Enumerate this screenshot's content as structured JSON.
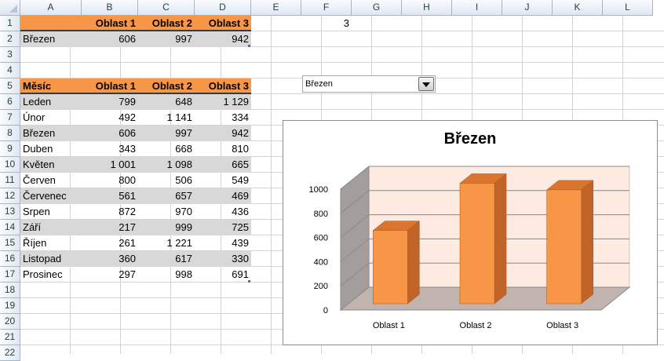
{
  "columns": [
    "A",
    "B",
    "C",
    "D",
    "E",
    "F",
    "G",
    "H",
    "I",
    "J",
    "K",
    "L"
  ],
  "rows": [
    "1",
    "2",
    "3",
    "4",
    "5",
    "6",
    "7",
    "8",
    "9",
    "10",
    "11",
    "12",
    "13",
    "14",
    "15",
    "16",
    "17",
    "18",
    "19",
    "20",
    "21",
    "22"
  ],
  "top_table": {
    "headers": [
      "Oblast 1",
      "Oblast 2",
      "Oblast 3"
    ],
    "row": {
      "label": "Březen",
      "values": [
        "606",
        "997",
        "942"
      ]
    }
  },
  "f1_value": "3",
  "main_table": {
    "headers": [
      "Měsíc",
      "Oblast 1",
      "Oblast 2",
      "Oblast 3"
    ],
    "rows": [
      [
        "Leden",
        "799",
        "648",
        "1 129"
      ],
      [
        "Únor",
        "492",
        "1 141",
        "334"
      ],
      [
        "Březen",
        "606",
        "997",
        "942"
      ],
      [
        "Duben",
        "343",
        "668",
        "810"
      ],
      [
        "Květen",
        "1 001",
        "1 098",
        "665"
      ],
      [
        "Červen",
        "800",
        "506",
        "549"
      ],
      [
        "Červenec",
        "561",
        "657",
        "469"
      ],
      [
        "Srpen",
        "872",
        "970",
        "436"
      ],
      [
        "Září",
        "217",
        "999",
        "725"
      ],
      [
        "Říjen",
        "261",
        "1 221",
        "439"
      ],
      [
        "Listopad",
        "360",
        "617",
        "330"
      ],
      [
        "Prosinec",
        "297",
        "998",
        "691"
      ]
    ]
  },
  "combo": {
    "selected": "Březen",
    "button_icon": "chevron-down-icon"
  },
  "chart_data": {
    "type": "bar",
    "title": "Březen",
    "categories": [
      "Oblast 1",
      "Oblast 2",
      "Oblast 3"
    ],
    "values": [
      606,
      997,
      942
    ],
    "ylim": [
      0,
      1000
    ],
    "yticks": [
      "0",
      "200",
      "400",
      "600",
      "800",
      "1000"
    ],
    "grid": true,
    "bar_color": "#f79646",
    "bar_side_color": "#c0642a",
    "wall_color": "#a39e9b",
    "back_wall_color": "#fdeae0",
    "floor_color": "#c1b3ad"
  }
}
